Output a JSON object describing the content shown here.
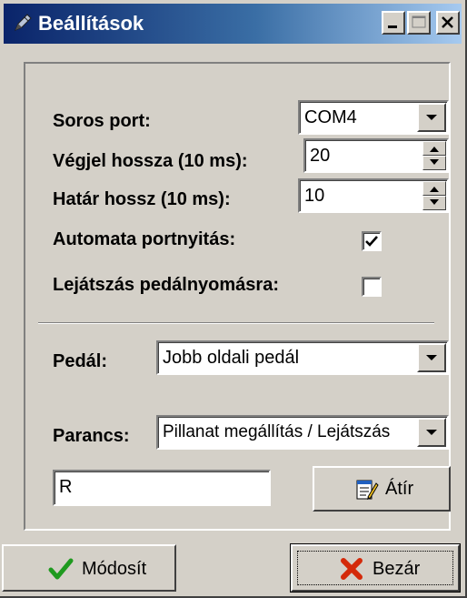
{
  "window": {
    "title": "Beállítások",
    "icon": "pencil-icon"
  },
  "titlebar_buttons": {
    "minimize_icon": "minimize-icon",
    "maximize_icon": "maximize-icon",
    "close_icon": "close-icon"
  },
  "form": {
    "serial_port": {
      "label": "Soros port:",
      "value": "COM4"
    },
    "end_signal_length": {
      "label": "Végjel hossza (10 ms):",
      "value": "20"
    },
    "limit_length": {
      "label": "Határ hossz (10 ms):",
      "value": "10"
    },
    "auto_port_open": {
      "label": "Automata portnyitás:",
      "checked": true
    },
    "play_on_pedal": {
      "label": "Lejátszás pedálnyomásra:",
      "checked": false
    },
    "pedal": {
      "label": "Pedál:",
      "value": "Jobb oldali pedál"
    },
    "command": {
      "label": "Parancs:",
      "value": "Pillanat megállítás / Lejátszás"
    },
    "command_key": {
      "value": "R"
    },
    "rewrite_button": {
      "label": "Átír",
      "icon": "notepad-edit-icon"
    }
  },
  "footer": {
    "modify_button": {
      "label": "Módosít",
      "icon": "checkmark-icon",
      "icon_color": "#1f9a1f"
    },
    "close_button": {
      "label": "Bezár",
      "icon": "x-mark-icon",
      "icon_color": "#d42a0a"
    }
  },
  "colors": {
    "titlebar_start": "#0a246a",
    "titlebar_end": "#a6caf0",
    "face": "#d4d0c8"
  }
}
